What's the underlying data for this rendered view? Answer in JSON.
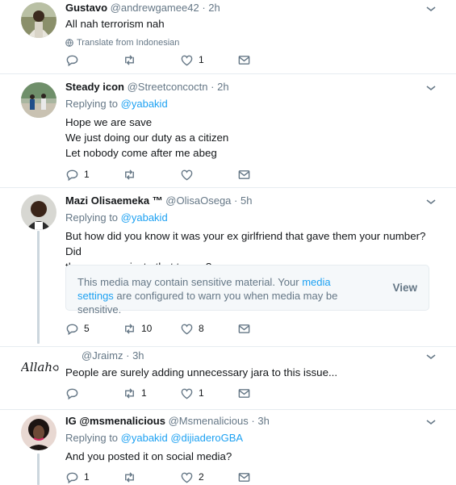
{
  "tweets": [
    {
      "name": "Gustavo",
      "handle": "@andrewgamee42",
      "time": "2h",
      "text": "All nah terrorism nah",
      "translate": "Translate from Indonesian",
      "actions": {
        "reply": "",
        "retweet": "",
        "like": "1"
      }
    },
    {
      "name": "Steady icon",
      "handle": "@Streetconcoctn",
      "time": "2h",
      "replying_label": "Replying to",
      "replying_to": "@yabakid",
      "text_lines": [
        "Hope we are save",
        "We just doing our duty as a citizen",
        "Let nobody come after me abeg"
      ],
      "actions": {
        "reply": "1",
        "retweet": "",
        "like": ""
      }
    },
    {
      "name": "Mazi Olisaemeka ™",
      "handle": "@OlisaOsega",
      "time": "5h",
      "replying_label": "Replying to",
      "replying_to": "@yabakid",
      "text_lines": [
        "But how did you know it was your ex girlfriend that gave them your number? Did",
        "they communicate that to you?"
      ],
      "sensitive": {
        "before": "This media may contain sensitive material. Your ",
        "link": "media settings",
        "after": " are configured to warn you when media may be sensitive.",
        "button": "View"
      },
      "actions": {
        "reply": "5",
        "retweet": "10",
        "like": "8"
      }
    },
    {
      "name": "",
      "handle": "@Jraimz",
      "time": "3h",
      "signature": "Allah",
      "text": "People are surely adding unnecessary jara to this issue...",
      "actions": {
        "reply": "",
        "retweet": "1",
        "like": "1"
      }
    },
    {
      "name": "IG @msmenalicious",
      "handle": "@Msmenalicious",
      "time": "3h",
      "replying_label": "Replying to",
      "replying_to": "@yabakid",
      "replying_to_2": "@dijiaderoGBA",
      "text": "And you posted it on social media?",
      "actions": {
        "reply": "1",
        "retweet": "",
        "like": "2"
      }
    }
  ],
  "separator": "·",
  "icons": [
    "reply-icon",
    "retweet-icon",
    "like-icon",
    "dm-icon",
    "caret-icon",
    "globe-icon"
  ],
  "colors": {
    "link": "#1da1f2",
    "muted": "#657786",
    "text": "#14171a",
    "thread": "#ccd6dd"
  }
}
